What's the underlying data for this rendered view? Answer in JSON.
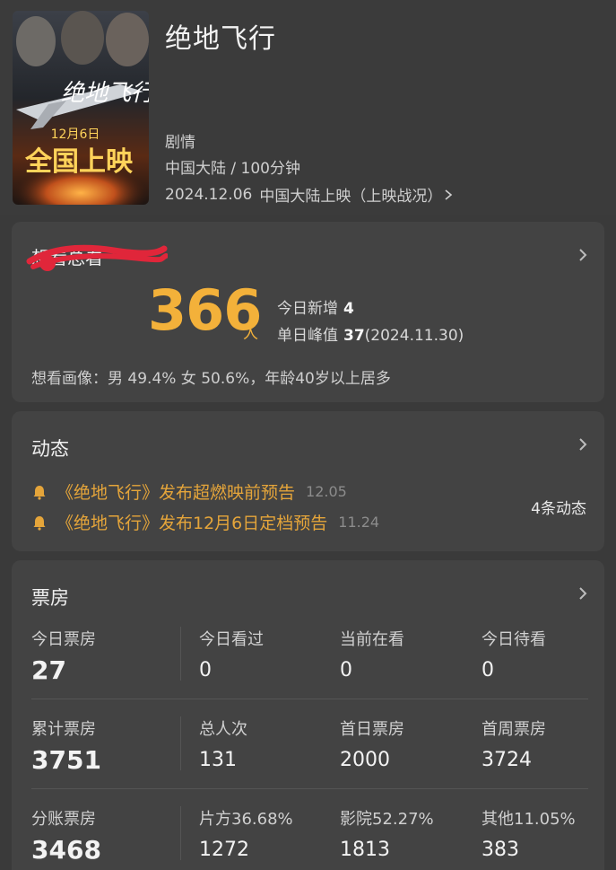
{
  "movie": {
    "title": "绝地飞行",
    "genre": "剧情",
    "region_duration": "中国大陆 / 100分钟",
    "release_date": "2024.12.06",
    "release_text": "中国大陆上映",
    "release_link": "（上映战况）",
    "poster": {
      "title_text": "绝地飞行",
      "date_text": "12月6日",
      "release_text": "全国上映"
    }
  },
  "want": {
    "title": "想看总看",
    "total": "366",
    "unit": "人",
    "today_new_label": "今日新增",
    "today_new_value": "4",
    "peak_label": "单日峰值",
    "peak_value": "37",
    "peak_date": "(2024.11.30)",
    "portrait": "想看画像：男 49.4%  女 50.6%，年龄40岁以上居多"
  },
  "dynamics": {
    "title": "动态",
    "count": "4条动态",
    "items": [
      {
        "text": "《绝地飞行》发布超燃映前预告",
        "date": "12.05"
      },
      {
        "text": "《绝地飞行》发布12月6日定档预告",
        "date": "11.24"
      }
    ]
  },
  "box_office": {
    "title": "票房",
    "rows": [
      [
        {
          "label": "今日票房",
          "value": "27"
        },
        {
          "label": "今日看过",
          "value": "0"
        },
        {
          "label": "当前在看",
          "value": "0"
        },
        {
          "label": "今日待看",
          "value": "0"
        }
      ],
      [
        {
          "label": "累计票房",
          "value": "3751"
        },
        {
          "label": "总人次",
          "value": "131"
        },
        {
          "label": "首日票房",
          "value": "2000"
        },
        {
          "label": "首周票房",
          "value": "3724"
        }
      ],
      [
        {
          "label": "分账票房",
          "value": "3468"
        },
        {
          "label": "片方36.68%",
          "value": "1272"
        },
        {
          "label": "影院52.27%",
          "value": "1813"
        },
        {
          "label": "其他11.05%",
          "value": "383"
        }
      ]
    ]
  },
  "colors": {
    "accent": "#f3b13a",
    "news": "#e5a53a",
    "card_bg": "#434343",
    "page_bg": "#3a3a3a"
  }
}
